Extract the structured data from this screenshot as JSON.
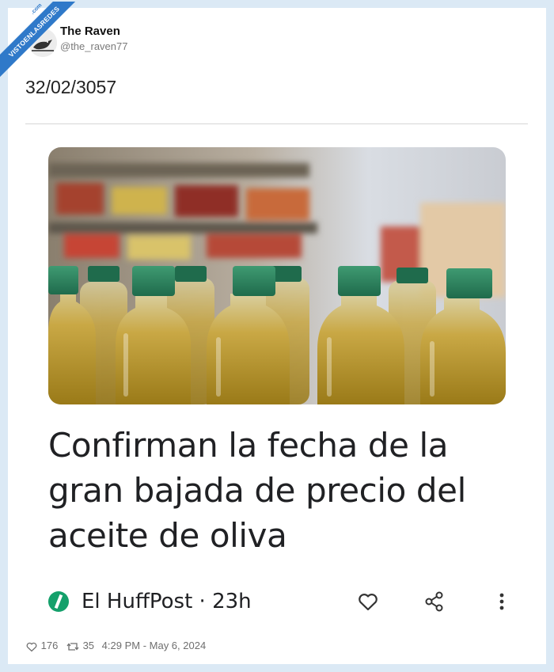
{
  "watermark": {
    "label": "VISTOENLASREDES",
    "sub": ".com"
  },
  "author": {
    "name": "The Raven",
    "handle": "@the_raven77"
  },
  "tweet": {
    "text": "32/02/3057"
  },
  "article": {
    "headline": "Confirman la fecha de la gran bajada de precio del aceite de oliva",
    "source_name": "El HuffPost",
    "separator": "·",
    "age": "23h",
    "icons": [
      "heart-icon",
      "share-icon",
      "more-vertical-icon"
    ],
    "logo_color": "#14a06b"
  },
  "stats": {
    "likes": "176",
    "retweets": "35",
    "timestamp": "4:29 PM - May 6, 2024"
  }
}
